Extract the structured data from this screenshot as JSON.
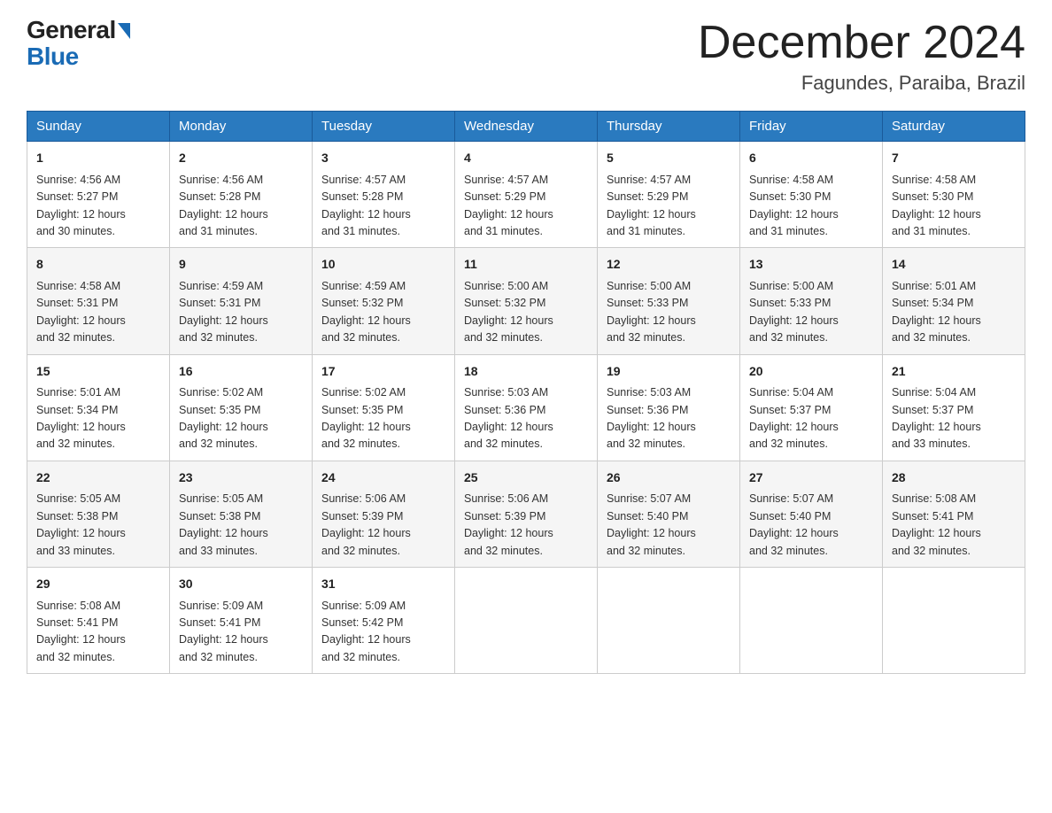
{
  "header": {
    "logo_general": "General",
    "logo_blue": "Blue",
    "month_title": "December 2024",
    "location": "Fagundes, Paraiba, Brazil"
  },
  "days_of_week": [
    "Sunday",
    "Monday",
    "Tuesday",
    "Wednesday",
    "Thursday",
    "Friday",
    "Saturday"
  ],
  "weeks": [
    [
      {
        "day": "1",
        "sunrise": "4:56 AM",
        "sunset": "5:27 PM",
        "daylight": "12 hours and 30 minutes."
      },
      {
        "day": "2",
        "sunrise": "4:56 AM",
        "sunset": "5:28 PM",
        "daylight": "12 hours and 31 minutes."
      },
      {
        "day": "3",
        "sunrise": "4:57 AM",
        "sunset": "5:28 PM",
        "daylight": "12 hours and 31 minutes."
      },
      {
        "day": "4",
        "sunrise": "4:57 AM",
        "sunset": "5:29 PM",
        "daylight": "12 hours and 31 minutes."
      },
      {
        "day": "5",
        "sunrise": "4:57 AM",
        "sunset": "5:29 PM",
        "daylight": "12 hours and 31 minutes."
      },
      {
        "day": "6",
        "sunrise": "4:58 AM",
        "sunset": "5:30 PM",
        "daylight": "12 hours and 31 minutes."
      },
      {
        "day": "7",
        "sunrise": "4:58 AM",
        "sunset": "5:30 PM",
        "daylight": "12 hours and 31 minutes."
      }
    ],
    [
      {
        "day": "8",
        "sunrise": "4:58 AM",
        "sunset": "5:31 PM",
        "daylight": "12 hours and 32 minutes."
      },
      {
        "day": "9",
        "sunrise": "4:59 AM",
        "sunset": "5:31 PM",
        "daylight": "12 hours and 32 minutes."
      },
      {
        "day": "10",
        "sunrise": "4:59 AM",
        "sunset": "5:32 PM",
        "daylight": "12 hours and 32 minutes."
      },
      {
        "day": "11",
        "sunrise": "5:00 AM",
        "sunset": "5:32 PM",
        "daylight": "12 hours and 32 minutes."
      },
      {
        "day": "12",
        "sunrise": "5:00 AM",
        "sunset": "5:33 PM",
        "daylight": "12 hours and 32 minutes."
      },
      {
        "day": "13",
        "sunrise": "5:00 AM",
        "sunset": "5:33 PM",
        "daylight": "12 hours and 32 minutes."
      },
      {
        "day": "14",
        "sunrise": "5:01 AM",
        "sunset": "5:34 PM",
        "daylight": "12 hours and 32 minutes."
      }
    ],
    [
      {
        "day": "15",
        "sunrise": "5:01 AM",
        "sunset": "5:34 PM",
        "daylight": "12 hours and 32 minutes."
      },
      {
        "day": "16",
        "sunrise": "5:02 AM",
        "sunset": "5:35 PM",
        "daylight": "12 hours and 32 minutes."
      },
      {
        "day": "17",
        "sunrise": "5:02 AM",
        "sunset": "5:35 PM",
        "daylight": "12 hours and 32 minutes."
      },
      {
        "day": "18",
        "sunrise": "5:03 AM",
        "sunset": "5:36 PM",
        "daylight": "12 hours and 32 minutes."
      },
      {
        "day": "19",
        "sunrise": "5:03 AM",
        "sunset": "5:36 PM",
        "daylight": "12 hours and 32 minutes."
      },
      {
        "day": "20",
        "sunrise": "5:04 AM",
        "sunset": "5:37 PM",
        "daylight": "12 hours and 32 minutes."
      },
      {
        "day": "21",
        "sunrise": "5:04 AM",
        "sunset": "5:37 PM",
        "daylight": "12 hours and 33 minutes."
      }
    ],
    [
      {
        "day": "22",
        "sunrise": "5:05 AM",
        "sunset": "5:38 PM",
        "daylight": "12 hours and 33 minutes."
      },
      {
        "day": "23",
        "sunrise": "5:05 AM",
        "sunset": "5:38 PM",
        "daylight": "12 hours and 33 minutes."
      },
      {
        "day": "24",
        "sunrise": "5:06 AM",
        "sunset": "5:39 PM",
        "daylight": "12 hours and 32 minutes."
      },
      {
        "day": "25",
        "sunrise": "5:06 AM",
        "sunset": "5:39 PM",
        "daylight": "12 hours and 32 minutes."
      },
      {
        "day": "26",
        "sunrise": "5:07 AM",
        "sunset": "5:40 PM",
        "daylight": "12 hours and 32 minutes."
      },
      {
        "day": "27",
        "sunrise": "5:07 AM",
        "sunset": "5:40 PM",
        "daylight": "12 hours and 32 minutes."
      },
      {
        "day": "28",
        "sunrise": "5:08 AM",
        "sunset": "5:41 PM",
        "daylight": "12 hours and 32 minutes."
      }
    ],
    [
      {
        "day": "29",
        "sunrise": "5:08 AM",
        "sunset": "5:41 PM",
        "daylight": "12 hours and 32 minutes."
      },
      {
        "day": "30",
        "sunrise": "5:09 AM",
        "sunset": "5:41 PM",
        "daylight": "12 hours and 32 minutes."
      },
      {
        "day": "31",
        "sunrise": "5:09 AM",
        "sunset": "5:42 PM",
        "daylight": "12 hours and 32 minutes."
      },
      null,
      null,
      null,
      null
    ]
  ],
  "labels": {
    "sunrise_prefix": "Sunrise: ",
    "sunset_prefix": "Sunset: ",
    "daylight_prefix": "Daylight: "
  }
}
